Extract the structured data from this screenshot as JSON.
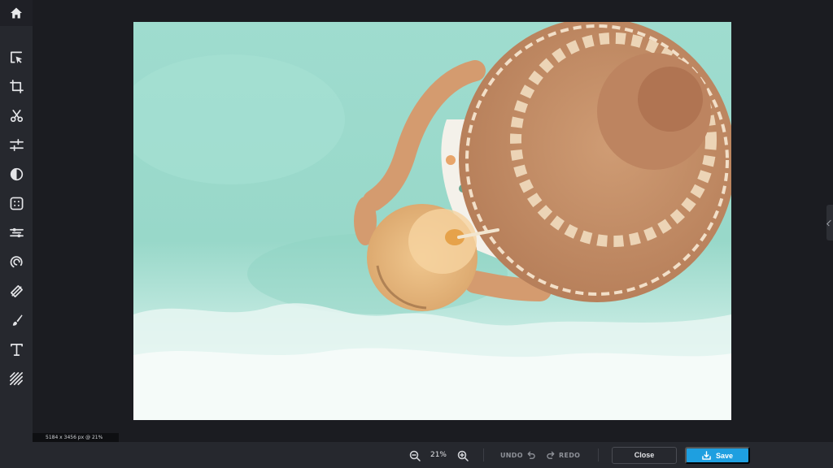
{
  "sidebar": {
    "home_icon": "home-icon",
    "tools": [
      {
        "name": "select",
        "icon": "pointer-icon"
      },
      {
        "name": "crop",
        "icon": "crop-icon"
      },
      {
        "name": "cut",
        "icon": "scissors-icon"
      },
      {
        "name": "adjust",
        "icon": "sliders-icon"
      },
      {
        "name": "filter",
        "icon": "contrast-icon"
      },
      {
        "name": "frames",
        "icon": "frame-icon"
      },
      {
        "name": "effects",
        "icon": "effects-icon"
      },
      {
        "name": "liquify",
        "icon": "swirl-icon"
      },
      {
        "name": "heal",
        "icon": "bandage-icon"
      },
      {
        "name": "paint",
        "icon": "brush-icon"
      },
      {
        "name": "text",
        "icon": "text-icon"
      },
      {
        "name": "texture",
        "icon": "hatch-icon"
      }
    ]
  },
  "canvas": {
    "image_subject": "beach-photo",
    "dimensions_label": "5184 x 3456 px @ 21%"
  },
  "bottom_bar": {
    "zoom_level": "21%",
    "undo_label": "UNDO",
    "redo_label": "REDO",
    "close_label": "Close",
    "save_label": "Save"
  },
  "colors": {
    "accent": "#1e9fe0",
    "sidebar_bg": "#26282e",
    "workspace_bg": "#1b1c21"
  }
}
